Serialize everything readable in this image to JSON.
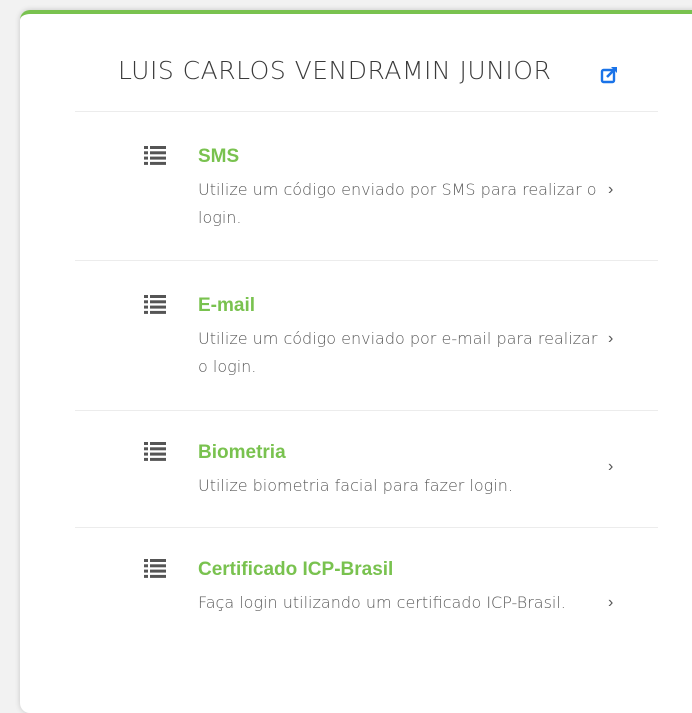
{
  "user": {
    "name": "LUIS CARLOS VENDRAMIN JUNIOR",
    "action_icon": "external-link-icon"
  },
  "colors": {
    "accent": "#79c24f",
    "share_icon": "#1a73e8",
    "text": "#5a5a5a"
  },
  "options": [
    {
      "title": "SMS",
      "description": "Utilize um código enviado por SMS para realizar o login.",
      "icon": "list-icon",
      "chevron": "›"
    },
    {
      "title": "E-mail",
      "description": "Utilize um código enviado por e-mail para realizar o login.",
      "icon": "list-icon",
      "chevron": "›"
    },
    {
      "title": "Biometria",
      "description": "Utilize biometria facial para fazer login.",
      "icon": "list-icon",
      "chevron": "›"
    },
    {
      "title": "Certificado ICP-Brasil",
      "description": "Faça login utilizando um certificado ICP-Brasil.",
      "icon": "list-icon",
      "chevron": "›"
    }
  ]
}
